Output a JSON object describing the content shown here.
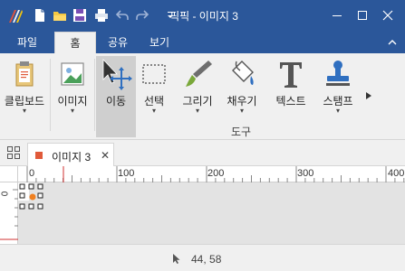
{
  "app": {
    "title": "픽픽 - 이미지 3"
  },
  "colors": {
    "accent": "#2b579a",
    "canvas_bg": "#e3e3e3",
    "handle_dot": "#f08020"
  },
  "menu": {
    "tabs": [
      "파일",
      "홈",
      "공유",
      "보기"
    ],
    "active": "홈"
  },
  "ribbon": {
    "clipboard": {
      "label": "클립보드",
      "arrow": "▾",
      "icon": "clipboard-icon"
    },
    "image": {
      "label": "이미지",
      "arrow": "▾",
      "icon": "image-icon"
    },
    "move": {
      "label": "이동",
      "icon": "move-icon"
    },
    "select": {
      "label": "선택",
      "arrow": "▾",
      "icon": "selection-rect-icon"
    },
    "draw": {
      "label": "그리기",
      "arrow": "▾",
      "icon": "brush-icon"
    },
    "fill": {
      "label": "채우기",
      "arrow": "▾",
      "icon": "paint-bucket-icon"
    },
    "text": {
      "label": "텍스트",
      "icon": "text-icon"
    },
    "stamp": {
      "label": "스탬프",
      "arrow": "▾",
      "icon": "stamp-icon"
    },
    "group_label": "도구"
  },
  "document_tab": {
    "name": "이미지 3",
    "close": "✕"
  },
  "ruler": {
    "top_labels": [
      "0",
      "100",
      "200",
      "300",
      "400"
    ],
    "left_labels": [
      "0"
    ]
  },
  "status": {
    "coords": "44, 58"
  }
}
